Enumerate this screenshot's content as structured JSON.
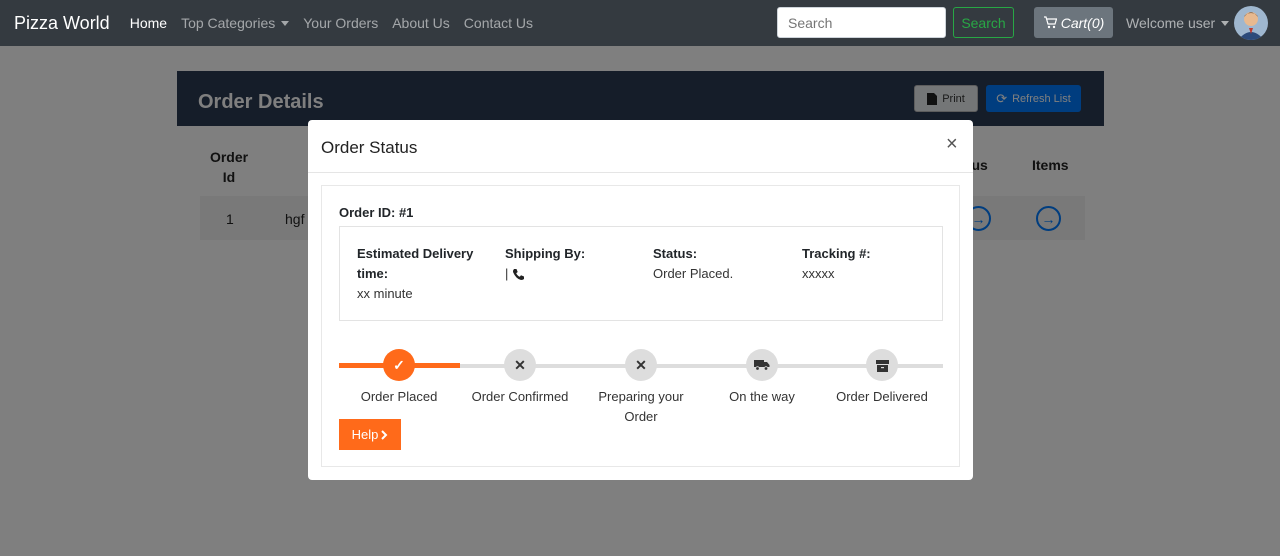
{
  "navbar": {
    "brand": "Pizza World",
    "items": [
      {
        "label": "Home",
        "active": true
      },
      {
        "label": "Top Categories",
        "dropdown": true
      },
      {
        "label": "Your Orders"
      },
      {
        "label": "About Us"
      },
      {
        "label": "Contact Us"
      }
    ],
    "search_placeholder": "Search",
    "search_button": "Search",
    "cart_label": "Cart(0)",
    "welcome": "Welcome user"
  },
  "page": {
    "title": "Order Details",
    "print_label": "Print",
    "refresh_label": "Refresh List",
    "table_headers": [
      "Order\nId",
      "Status",
      "Items"
    ],
    "row": {
      "order_id": "1",
      "name_partial": "hgf"
    }
  },
  "modal": {
    "title": "Order Status",
    "close": "×",
    "order_id_label": "Order ID: #1",
    "info": {
      "delivery_label": "Estimated Delivery time:",
      "delivery_value": "xx minute",
      "shipping_label": "Shipping By:",
      "shipping_value": "|",
      "status_label": "Status:",
      "status_value": "Order Placed.",
      "tracking_label": "Tracking #:",
      "tracking_value": "xxxxx"
    },
    "steps": [
      {
        "label": "Order Placed",
        "icon": "check-icon",
        "done": true
      },
      {
        "label": "Order Confirmed",
        "icon": "times-icon",
        "done": false
      },
      {
        "label": "Preparing your Order",
        "icon": "times-icon",
        "done": false
      },
      {
        "label": "On the way",
        "icon": "truck-icon",
        "done": false
      },
      {
        "label": "Order Delivered",
        "icon": "box-icon",
        "done": false
      }
    ],
    "help_label": "Help"
  },
  "colors": {
    "accent": "#ff6a1a",
    "nav": "#343a40",
    "header": "#2b3a52",
    "primary": "#007bff"
  }
}
